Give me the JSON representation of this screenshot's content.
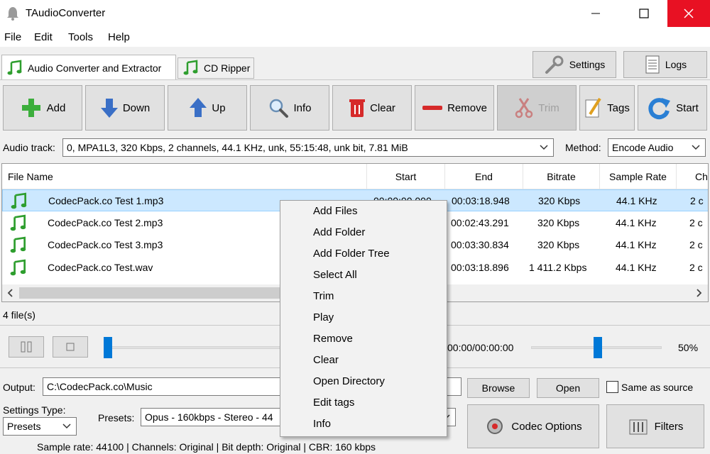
{
  "window": {
    "title": "TAudioConverter"
  },
  "menu": [
    "File",
    "Edit",
    "Tools",
    "Help"
  ],
  "tabs": [
    {
      "label": "Audio Converter and Extractor",
      "active": true
    },
    {
      "label": "CD Ripper",
      "active": false
    }
  ],
  "top_buttons": {
    "settings": "Settings",
    "logs": "Logs"
  },
  "toolbar": {
    "add": "Add",
    "down": "Down",
    "up": "Up",
    "info": "Info",
    "clear": "Clear",
    "remove": "Remove",
    "trim": "Trim",
    "tags": "Tags",
    "start": "Start"
  },
  "audio_track": {
    "label": "Audio track:",
    "value": "0, MPA1L3, 320 Kbps, 2 channels, 44.1 KHz, unk, 55:15:48, unk bit, 7.81 MiB"
  },
  "method": {
    "label": "Method:",
    "value": "Encode Audio"
  },
  "file_list": {
    "columns": [
      "File Name",
      "Start",
      "End",
      "Bitrate",
      "Sample Rate",
      "Ch"
    ],
    "rows": [
      {
        "name": "CodecPack.co Test 1.mp3",
        "start": "00:00:00.000",
        "end": "00:03:18.948",
        "bitrate": "320 Kbps",
        "rate": "44.1 KHz",
        "ch": "2 c"
      },
      {
        "name": "CodecPack.co Test 2.mp3",
        "start": "",
        "end": "00:02:43.291",
        "bitrate": "320 Kbps",
        "rate": "44.1 KHz",
        "ch": "2 c"
      },
      {
        "name": "CodecPack.co Test 3.mp3",
        "start": "",
        "end": "00:03:30.834",
        "bitrate": "320 Kbps",
        "rate": "44.1 KHz",
        "ch": "2 c"
      },
      {
        "name": "CodecPack.co Test.wav",
        "start": "",
        "end": "00:03:18.896",
        "bitrate": "1 411.2 Kbps",
        "rate": "44.1 KHz",
        "ch": "2 c"
      }
    ],
    "count": "4 file(s)"
  },
  "player": {
    "time": "00:00/00:00:00",
    "volume": "50%",
    "volume_level": 0.5,
    "position_level": 0.0
  },
  "output": {
    "label": "Output:",
    "path": "C:\\CodecPack.co\\Music",
    "browse": "Browse",
    "open": "Open",
    "same_as_source": "Same as source"
  },
  "settings_type": {
    "label": "Settings Type:",
    "value": "Presets"
  },
  "presets": {
    "label": "Presets:",
    "value": "Opus - 160kbps - Stereo - 44"
  },
  "codec_options": "Codec Options",
  "filters": "Filters",
  "status_line": "Sample rate: 44100 | Channels: Original | Bit depth: Original | CBR: 160 kbps",
  "context_menu": [
    "Add Files",
    "Add Folder",
    "Add Folder Tree",
    "Select All",
    "Trim",
    "Play",
    "Remove",
    "Clear",
    "Open Directory",
    "Edit tags",
    "Info"
  ],
  "colors": {
    "accent": "#0078d7",
    "close": "#e81123",
    "selection": "#cce8ff",
    "music_green": "#2e9e2e"
  }
}
